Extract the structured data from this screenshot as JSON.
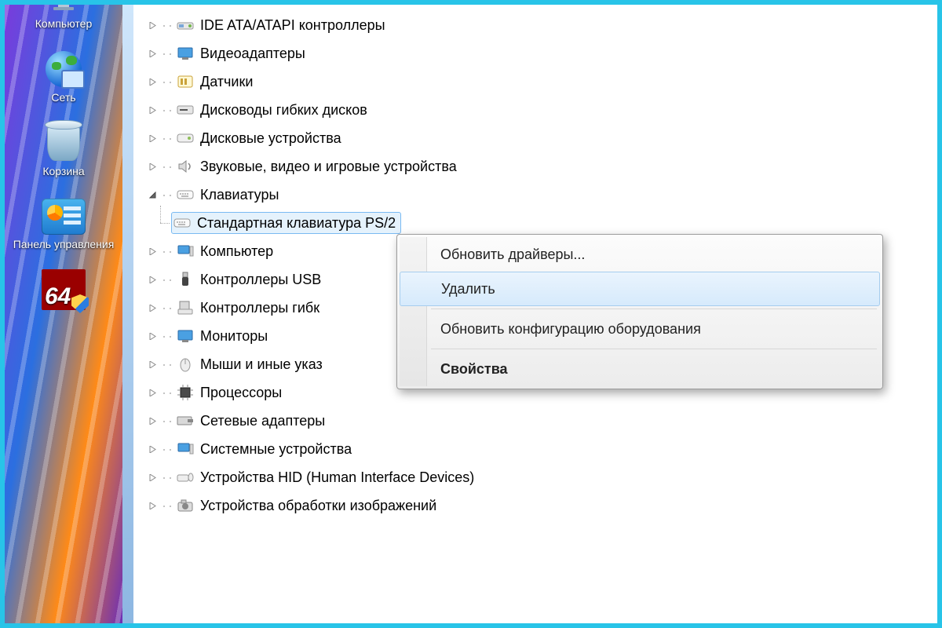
{
  "desktop": {
    "icons": [
      {
        "label": "Компьютер",
        "kind": "computer"
      },
      {
        "label": "Сеть",
        "kind": "network"
      },
      {
        "label": "Корзина",
        "kind": "recycle-bin"
      },
      {
        "label": "Панель управления",
        "kind": "control-panel"
      },
      {
        "label": "64",
        "kind": "aida64"
      }
    ]
  },
  "tree": {
    "items": [
      {
        "label": "IDE ATA/ATAPI контроллеры",
        "icon": "ide"
      },
      {
        "label": "Видеоадаптеры",
        "icon": "display"
      },
      {
        "label": "Датчики",
        "icon": "sensor"
      },
      {
        "label": "Дисководы гибких дисков",
        "icon": "floppy"
      },
      {
        "label": "Дисковые устройства",
        "icon": "disk"
      },
      {
        "label": "Звуковые, видео и игровые устройства",
        "icon": "sound"
      },
      {
        "label": "Клавиатуры",
        "icon": "keyboard",
        "expanded": true,
        "children": [
          {
            "label": "Стандартная клавиатура PS/2",
            "icon": "keyboard",
            "selected": true
          }
        ]
      },
      {
        "label": "Компьютер",
        "icon": "computer"
      },
      {
        "label": "Контроллеры USB",
        "icon": "usb"
      },
      {
        "label": "Контроллеры гибк",
        "icon": "floppyctl"
      },
      {
        "label": "Мониторы",
        "icon": "display"
      },
      {
        "label": "Мыши и иные указ",
        "icon": "mouse"
      },
      {
        "label": "Процессоры",
        "icon": "cpu"
      },
      {
        "label": "Сетевые адаптеры",
        "icon": "nic"
      },
      {
        "label": "Системные устройства",
        "icon": "system"
      },
      {
        "label": "Устройства HID (Human Interface Devices)",
        "icon": "hid"
      },
      {
        "label": "Устройства обработки изображений",
        "icon": "imaging"
      }
    ]
  },
  "context_menu": {
    "items": [
      {
        "label": "Обновить драйверы...",
        "hover": false
      },
      {
        "label": "Удалить",
        "hover": true
      },
      {
        "sep": true
      },
      {
        "label": "Обновить конфигурацию оборудования",
        "hover": false
      },
      {
        "sep": true
      },
      {
        "label": "Свойства",
        "bold": true
      }
    ]
  }
}
